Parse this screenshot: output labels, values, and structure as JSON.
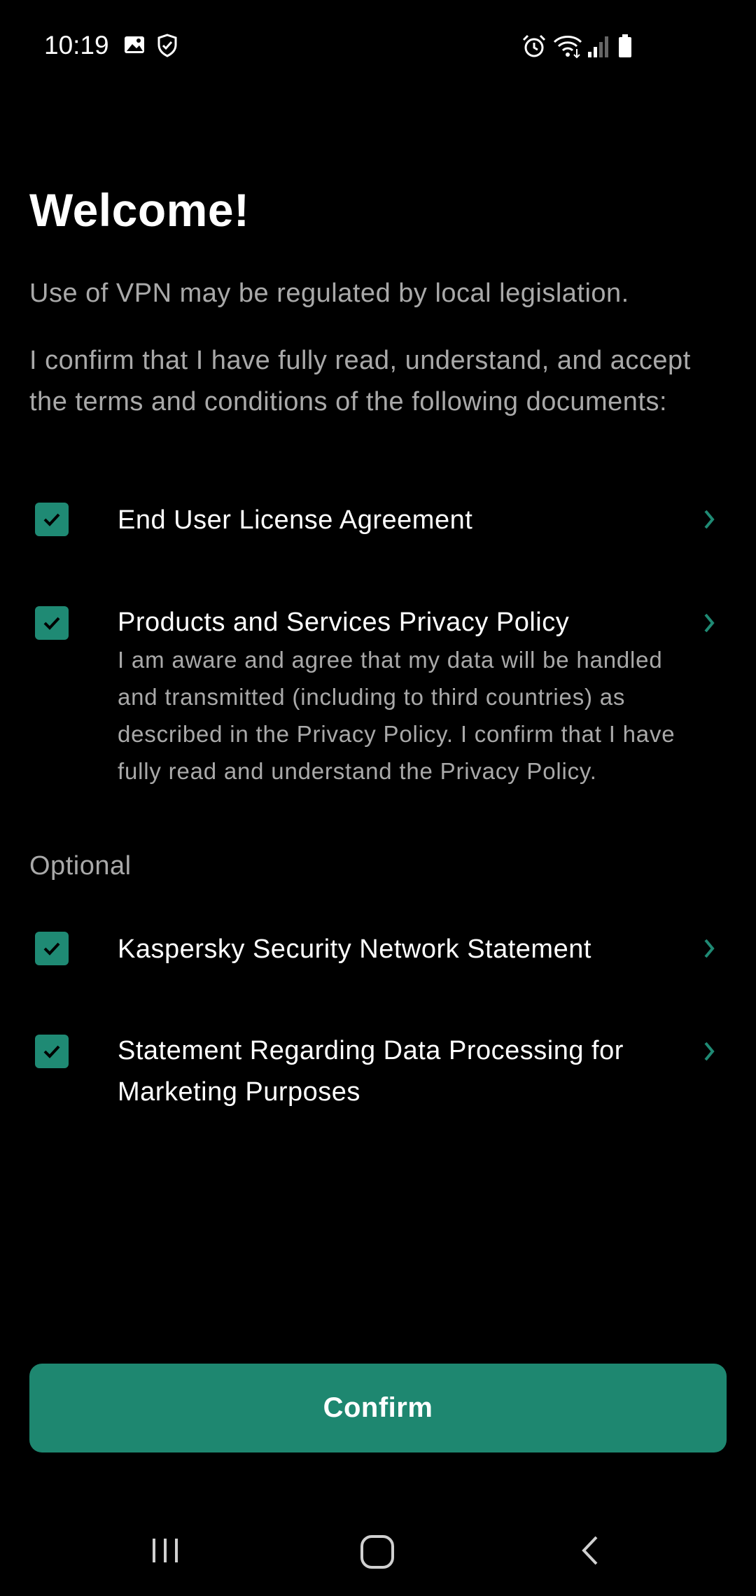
{
  "status_bar": {
    "time": "10:19",
    "icons": [
      "image-icon",
      "shield-check-icon",
      "alarm-icon",
      "wifi-icon",
      "signal-icon",
      "battery-icon"
    ]
  },
  "page": {
    "title": "Welcome!",
    "vpn_notice": "Use of VPN may be regulated by local legislation.",
    "confirm_text": "I confirm that I have fully read, understand, and accept the terms and conditions of the following documents:",
    "optional_label": "Optional"
  },
  "documents": [
    {
      "label": "End User License Agreement",
      "checked": true
    },
    {
      "label": "Products and Services Privacy Policy",
      "checked": true,
      "description": "I am aware and agree that my data will be handled and transmitted (including to third countries) as described in the Privacy Policy. I confirm that I have fully read and understand the Privacy Policy."
    },
    {
      "label": "Kaspersky Security Network Statement",
      "checked": true
    },
    {
      "label": "Statement Regarding Data Processing for Marketing Purposes",
      "checked": true
    }
  ],
  "confirm_button": {
    "label": "Confirm"
  },
  "nav_bar": {
    "icons": [
      "recent-apps-icon",
      "home-icon",
      "back-icon"
    ]
  },
  "colors": {
    "accent": "#1e8770",
    "background": "#000000",
    "secondary_text": "#a9a9a9"
  }
}
